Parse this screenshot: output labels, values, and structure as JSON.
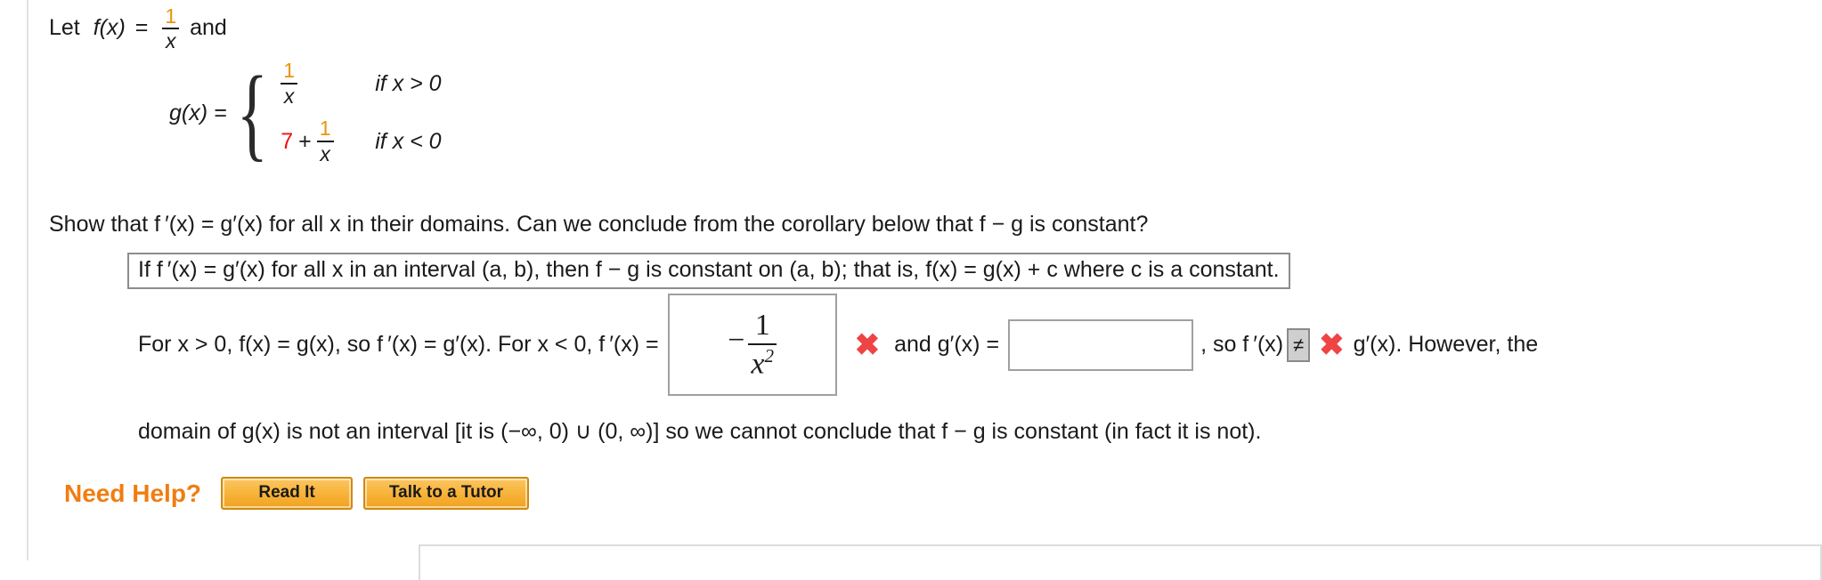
{
  "problem": {
    "let_line": {
      "prefix": "Let",
      "func_name": "f(x)",
      "equals": "=",
      "frac_num": "1",
      "frac_den": "x",
      "suffix": "and"
    },
    "piecewise": {
      "lhs": "g(x)  =",
      "rows": [
        {
          "value_numerator": "1",
          "value_denominator": "x",
          "leading_term": "",
          "plus": "",
          "condition": "if x > 0"
        },
        {
          "leading_term": "7",
          "plus": "+",
          "value_numerator": "1",
          "value_denominator": "x",
          "condition": "if x < 0"
        }
      ]
    },
    "show_line": "Show that  f ′(x) = g′(x)  for all x in their domains. Can we conclude from the corollary below that  f − g  is constant?",
    "corollary": "If  f ′(x) = g′(x)  for all x in an interval  (a, b),  then  f − g  is constant on  (a, b);  that is,  f(x) = g(x) + c  where c is a constant."
  },
  "work": {
    "segment_1": "For  x > 0, f(x) = g(x),  so  f ′(x) = g′(x).  For  x < 0, f ′(x) =",
    "answer_1": {
      "minus": "−",
      "numerator": "1",
      "denominator": "x",
      "exponent": "2",
      "value": "-1/x^2"
    },
    "mark_1": "✖",
    "segment_2": "and  g′(x) =",
    "answer_2": {
      "value": "",
      "placeholder": ""
    },
    "segment_3": ",  so  f ′(x)",
    "comparison_selected": "≠",
    "comparison_options": [
      "=",
      "≠",
      "<",
      ">"
    ],
    "mark_2": "✖",
    "segment_4": "g′(x).   However, the"
  },
  "conclusion": "domain of  g(x)  is not an interval [it is  (−∞, 0) ∪ (0, ∞)]  so we cannot conclude that  f − g  is constant (in fact it is not).",
  "need_help": {
    "label": "Need Help?",
    "buttons": [
      {
        "label": "Read It"
      },
      {
        "label": "Talk to a Tutor"
      }
    ]
  },
  "colors": {
    "accent_orange": "#f07d10",
    "math_orange": "#e8950c",
    "answer_red": "#ee1111",
    "mark_red": "#ef4444",
    "box_border": "#a0a0a0"
  }
}
